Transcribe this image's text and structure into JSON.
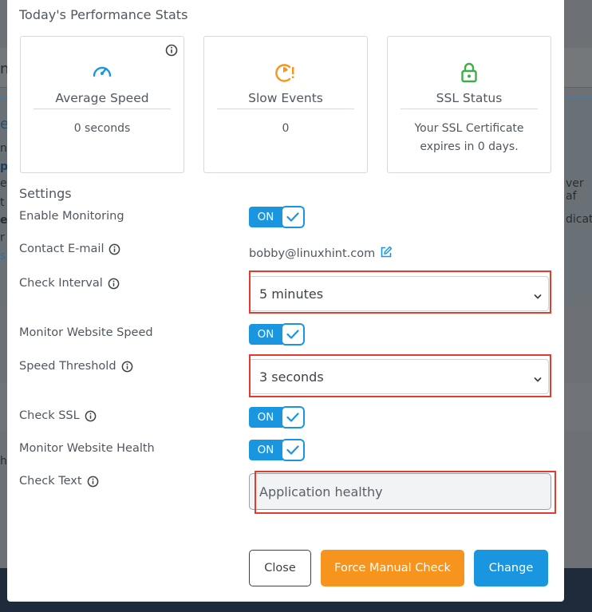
{
  "modal": {
    "title": "Today's Performance Stats"
  },
  "cards": [
    {
      "title": "Average Speed",
      "value": "0 seconds",
      "icon": "speedometer-icon"
    },
    {
      "title": "Slow Events",
      "value": "0",
      "icon": "slow-events-icon"
    },
    {
      "title": "SSL Status",
      "value": "Your SSL Certificate expires in 0 days.",
      "icon": "lock-icon"
    }
  ],
  "settings": {
    "title": "Settings",
    "enable_monitoring": {
      "label": "Enable Monitoring",
      "toggle": "ON"
    },
    "contact_email": {
      "label": "Contact E-mail",
      "value": "bobby@linuxhint.com"
    },
    "check_interval": {
      "label": "Check Interval",
      "selected": "5 minutes"
    },
    "monitor_speed": {
      "label": "Monitor Website Speed",
      "toggle": "ON"
    },
    "speed_threshold": {
      "label": "Speed Threshold",
      "selected": "3 seconds"
    },
    "check_ssl": {
      "label": "Check SSL",
      "toggle": "ON"
    },
    "monitor_health": {
      "label": "Monitor Website Health",
      "toggle": "ON"
    },
    "check_text": {
      "label": "Check Text",
      "value": "Application healthy"
    }
  },
  "buttons": {
    "close": "Close",
    "force": "Force Manual Check",
    "change": "Change"
  },
  "colors": {
    "accent": "#1a96e0",
    "orange": "#f7941d",
    "green": "#3fae49",
    "highlight": "#e33b2e"
  },
  "background": {
    "fragments": [
      "n",
      "e",
      "n",
      "p",
      "e",
      "t",
      "e",
      "r",
      "s",
      "h",
      "ver af",
      "dicati"
    ]
  }
}
